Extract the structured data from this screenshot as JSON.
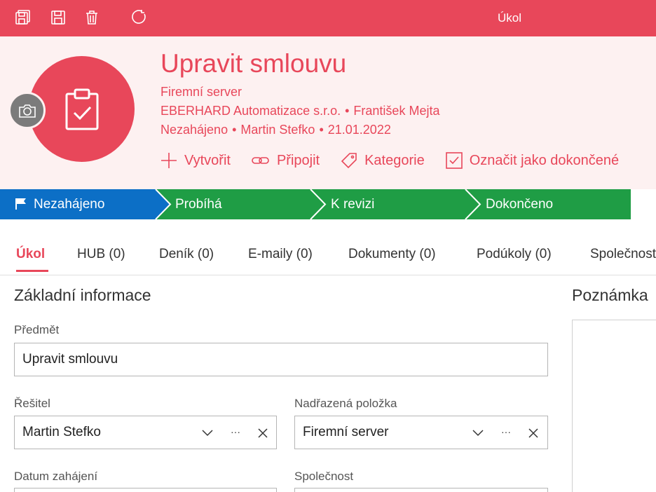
{
  "topbar": {
    "title": "Úkol",
    "icons": [
      "save-close-icon",
      "save-icon",
      "delete-icon",
      "refresh-icon"
    ]
  },
  "header": {
    "title": "Upravit smlouvu",
    "parent": "Firemní server",
    "company": "EBERHARD Automatizace s.r.o.",
    "contact": "František Mejta",
    "status": "Nezahájeno",
    "owner": "Martin Stefko",
    "date": "21.01.2022",
    "separator": "•",
    "actions": {
      "create": "Vytvořit",
      "connect": "Připojit",
      "category": "Kategorie",
      "mark_done": "Označit jako dokončené"
    }
  },
  "stages": [
    {
      "label": "Nezahájeno",
      "color": "#0c6fc6",
      "active": true
    },
    {
      "label": "Probíhá",
      "color": "#1f9d45"
    },
    {
      "label": "K revizi",
      "color": "#1f9d45"
    },
    {
      "label": "Dokončeno",
      "color": "#1f9d45"
    }
  ],
  "tabs": [
    {
      "label": "Úkol",
      "active": true
    },
    {
      "label": "HUB (0)"
    },
    {
      "label": "Deník (0)"
    },
    {
      "label": "E-maily (0)"
    },
    {
      "label": "Dokumenty (0)"
    },
    {
      "label": "Podúkoly (0)"
    },
    {
      "label": "Společnost"
    }
  ],
  "form": {
    "section_title": "Základní informace",
    "subject_label": "Předmět",
    "subject_value": "Upravit smlouvu",
    "assignee_label": "Řešitel",
    "assignee_value": "Martin Stefko",
    "parent_label": "Nadřazená položka",
    "parent_value": "Firemní server",
    "start_label": "Datum zahájení",
    "company_label": "Společnost",
    "more": "···"
  },
  "note": {
    "title": "Poznámka"
  },
  "colors": {
    "accent": "#e8475a",
    "header_bg": "#fdf1f1",
    "stage_active": "#0c6fc6",
    "stage_green": "#1f9d45"
  }
}
